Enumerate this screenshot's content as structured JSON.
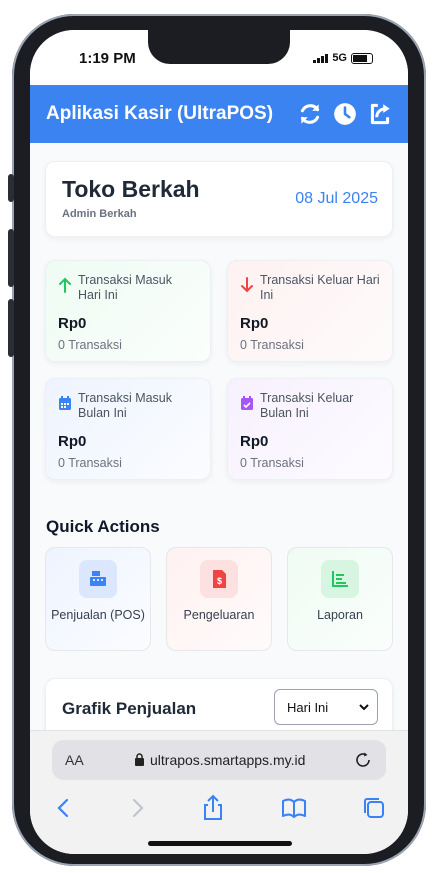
{
  "status": {
    "time": "1:19 PM",
    "network": "5G"
  },
  "app": {
    "title": "Aplikasi Kasir (UltraPOS)",
    "icons": [
      "refresh-icon",
      "clock-icon",
      "share-icon"
    ],
    "accent": "#3b83f0"
  },
  "store": {
    "name": "Toko Berkah",
    "admin": "Admin Berkah",
    "date": "08 Jul 2025"
  },
  "stats": [
    {
      "label": "Transaksi Masuk Hari Ini",
      "amount": "Rp0",
      "count": "0 Transaksi",
      "icon": "arrow-up-icon",
      "color": "#22c55e"
    },
    {
      "label": "Transaksi Keluar Hari Ini",
      "amount": "Rp0",
      "count": "0 Transaksi",
      "icon": "arrow-down-icon",
      "color": "#ef4444"
    },
    {
      "label": "Transaksi Masuk Bulan Ini",
      "amount": "Rp0",
      "count": "0 Transaksi",
      "icon": "calendar-icon",
      "color": "#3b82f6"
    },
    {
      "label": "Transaksi Keluar Bulan Ini",
      "amount": "Rp0",
      "count": "0 Transaksi",
      "icon": "calendar-check-icon",
      "color": "#a855f7"
    }
  ],
  "quick_actions": {
    "title": "Quick Actions",
    "items": [
      {
        "label": "Penjualan (POS)",
        "icon": "cash-register-icon"
      },
      {
        "label": "Pengeluaran",
        "icon": "invoice-dollar-icon"
      },
      {
        "label": "Laporan",
        "icon": "chart-icon"
      }
    ]
  },
  "sales_chart": {
    "title": "Grafik Penjualan",
    "period": "Hari Ini"
  },
  "browser": {
    "text_size": "AA",
    "url": "ultrapos.smartapps.my.id"
  }
}
